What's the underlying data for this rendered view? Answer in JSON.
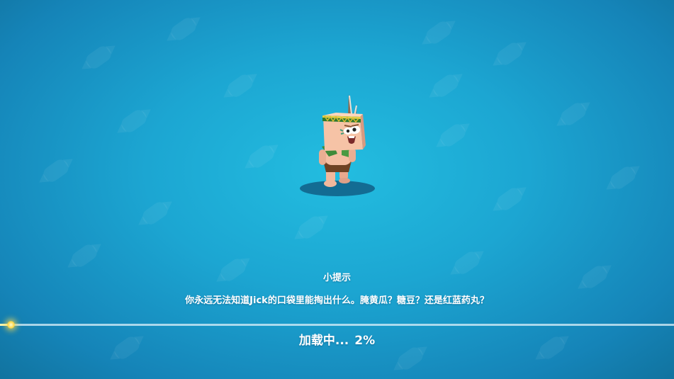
{
  "tip": {
    "title": "小提示",
    "text": "你永远无法知道Jick的口袋里能掏出什么。腌黄瓜？糖豆？还是红蓝药丸？"
  },
  "loading": {
    "label": "加载中...",
    "percent_text": "2%",
    "progress": 0.02
  },
  "colors": {
    "background": "#1ca6d2",
    "text": "#ffffff",
    "progress_fill": "#fff6b0",
    "progress_glow": "#ffd84a"
  },
  "character": {
    "icon": "jick-character-icon"
  }
}
